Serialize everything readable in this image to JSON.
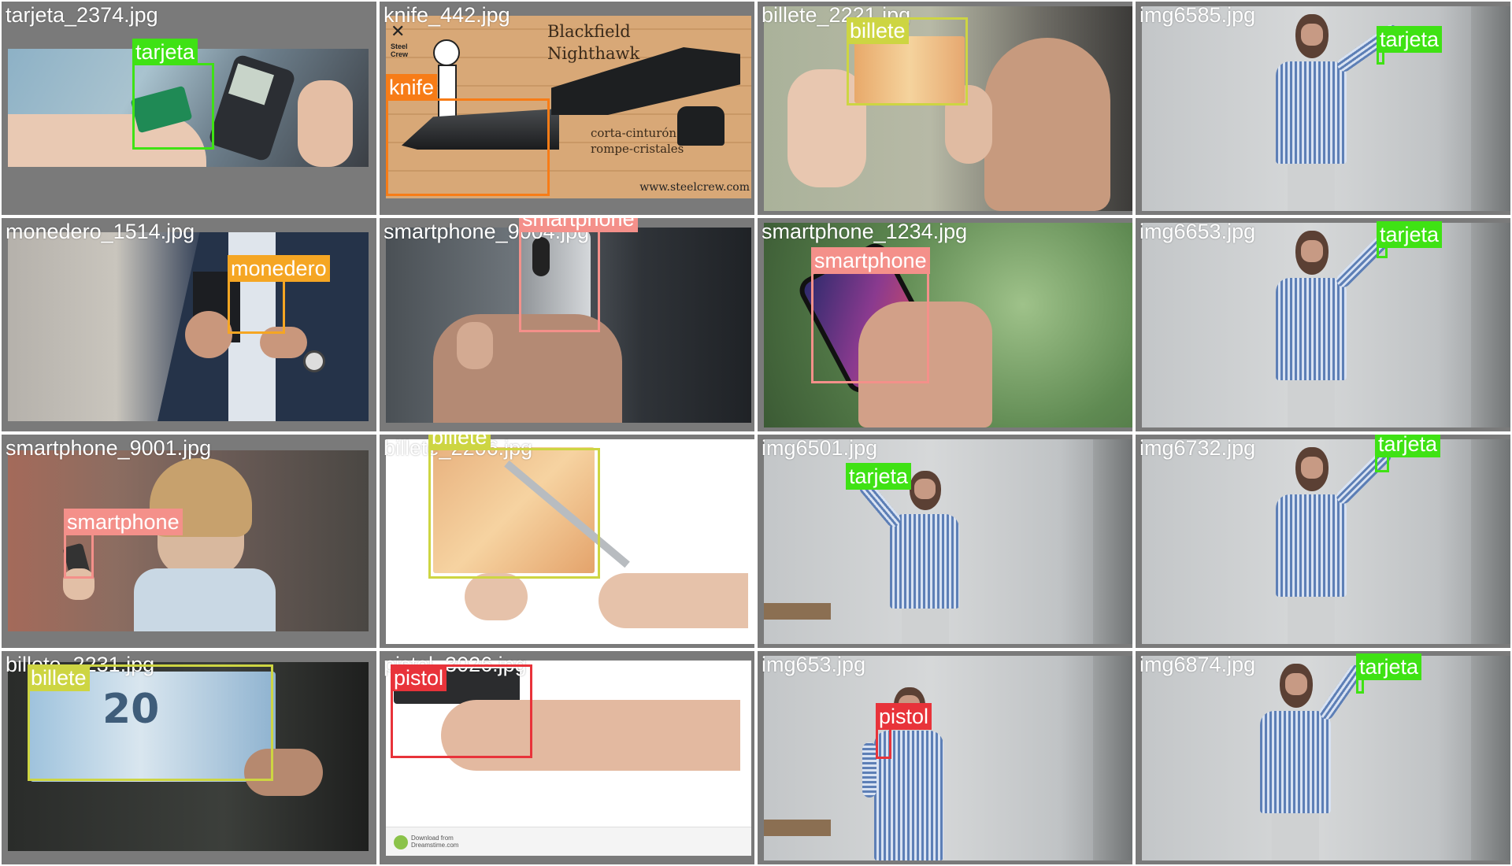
{
  "colors": {
    "tarjeta": "#3fe214",
    "knife": "#f77c17",
    "billete": "#cdd542",
    "monedero": "#f5a623",
    "smartphone": "#f4908a",
    "pistol": "#e8333a",
    "tile_background": "#7a7a7a"
  },
  "tiles": [
    {
      "filename": "tarjeta_2374.jpg",
      "scene": "card payment at terminal",
      "detections": [
        {
          "label": "tarjeta"
        }
      ]
    },
    {
      "filename": "knife_442.jpg",
      "scene": "folding knife advert",
      "ad_text": {
        "brand": "Blackfield",
        "model": "Nighthawk",
        "logo": "Steel Crew",
        "feature1": "corta-cinturón",
        "feature2": "rompe-cristales",
        "url": "www.steelcrew.com"
      },
      "detections": [
        {
          "label": "knife"
        }
      ]
    },
    {
      "filename": "billete_2221.jpg",
      "scene": "hands holding 50 euro note",
      "detections": [
        {
          "label": "billete"
        }
      ]
    },
    {
      "filename": "img6585.jpg",
      "scene": "man holding card",
      "detections": [
        {
          "label": "tarjeta"
        }
      ]
    },
    {
      "filename": "monedero_1514.jpg",
      "scene": "man putting wallet in jacket",
      "detections": [
        {
          "label": "monedero"
        }
      ]
    },
    {
      "filename": "smartphone_9004.jpg",
      "scene": "hand holding phone",
      "detections": [
        {
          "label": "smartphone"
        }
      ]
    },
    {
      "filename": "smartphone_1234.jpg",
      "scene": "hand holding phone",
      "detections": [
        {
          "label": "smartphone"
        }
      ]
    },
    {
      "filename": "img6653.jpg",
      "scene": "man holding card",
      "detections": [
        {
          "label": "tarjeta"
        }
      ]
    },
    {
      "filename": "smartphone_9001.jpg",
      "scene": "woman using phone",
      "detections": [
        {
          "label": "smartphone"
        }
      ]
    },
    {
      "filename": "billete_2206.jpg",
      "scene": "scissors cutting 50 euro note",
      "detections": [
        {
          "label": "billete"
        }
      ]
    },
    {
      "filename": "img6501.jpg",
      "scene": "man holding card",
      "detections": [
        {
          "label": "tarjeta"
        }
      ]
    },
    {
      "filename": "img6732.jpg",
      "scene": "man holding card",
      "detections": [
        {
          "label": "tarjeta"
        }
      ]
    },
    {
      "filename": "billete_2231.jpg",
      "scene": "20 euro note",
      "detections": [
        {
          "label": "billete"
        }
      ]
    },
    {
      "filename": "pistol_3026.jpg",
      "scene": "hand holding pistol",
      "footer": "Download from Dreamstime.com",
      "detections": [
        {
          "label": "pistol"
        }
      ]
    },
    {
      "filename": "img653.jpg",
      "scene": "man holding pistol",
      "detections": [
        {
          "label": "pistol"
        }
      ]
    },
    {
      "filename": "img6874.jpg",
      "scene": "man holding card",
      "detections": [
        {
          "label": "tarjeta"
        }
      ]
    }
  ]
}
